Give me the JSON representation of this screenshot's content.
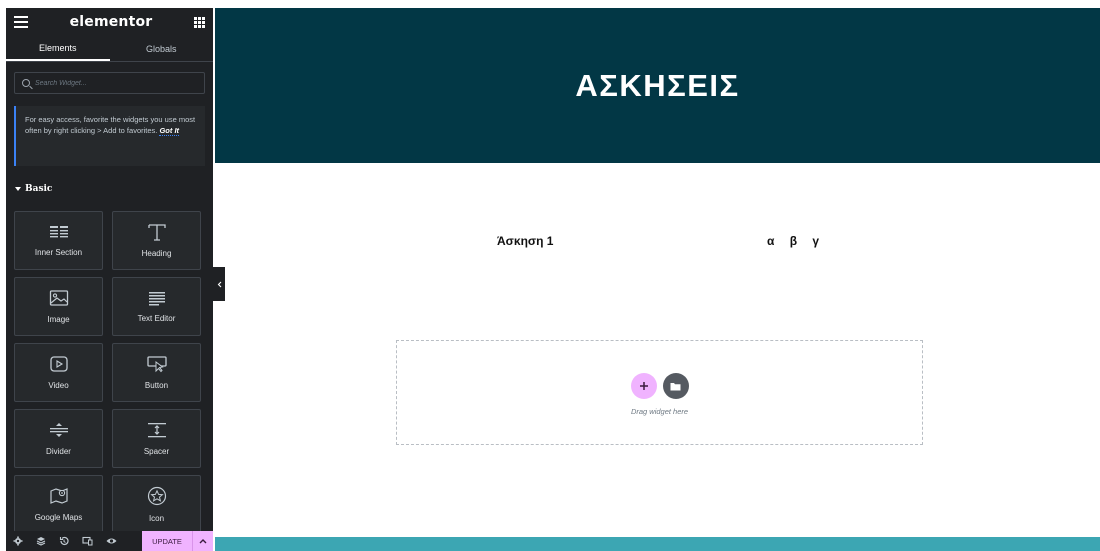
{
  "panel": {
    "brand": "elementor",
    "tabs": [
      {
        "label": "Elements",
        "active": true
      },
      {
        "label": "Globals",
        "active": false
      }
    ],
    "search_placeholder": "Search Widget...",
    "tip": {
      "text": "For easy access, favorite the widgets you use most often by right clicking > Add to favorites.",
      "link": "Got It"
    },
    "section_title": "Basic",
    "widgets": [
      {
        "label": "Inner Section",
        "icon": "inner-section-icon"
      },
      {
        "label": "Heading",
        "icon": "heading-icon"
      },
      {
        "label": "Image",
        "icon": "image-icon"
      },
      {
        "label": "Text Editor",
        "icon": "text-editor-icon"
      },
      {
        "label": "Video",
        "icon": "video-icon"
      },
      {
        "label": "Button",
        "icon": "button-icon"
      },
      {
        "label": "Divider",
        "icon": "divider-icon"
      },
      {
        "label": "Spacer",
        "icon": "spacer-icon"
      },
      {
        "label": "Google Maps",
        "icon": "google-maps-icon"
      },
      {
        "label": "Icon",
        "icon": "star-icon"
      }
    ],
    "footer": {
      "icons": [
        "settings-icon",
        "navigator-icon",
        "history-icon",
        "responsive-icon",
        "preview-icon"
      ],
      "update_label": "UPDATE"
    }
  },
  "canvas": {
    "hero_title": "ΑΣΚΗΣΕΙΣ",
    "row_left": "Άσκηση 1",
    "row_right": "α β γ",
    "dropzone_text": "Drag widget here"
  },
  "colors": {
    "panel_bg": "#1f2124",
    "hero_bg": "#023745",
    "accent_pink": "#f0b3ff",
    "tip_border": "#3b82f6",
    "bottom_strip": "#3ca6b3"
  }
}
